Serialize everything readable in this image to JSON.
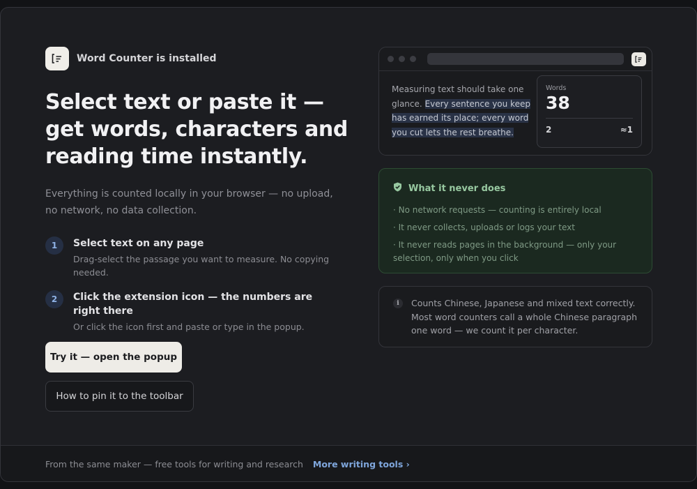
{
  "brand": {
    "name": "Word Counter is installed",
    "icon": "word-counter-logo-icon"
  },
  "hero": {
    "headline": "Select text or paste it — get words, characters and reading time instantly.",
    "subhead": "Everything is counted locally in your browser — no upload, no network, no data collection."
  },
  "steps": [
    {
      "number": "1",
      "title": "Select text on any page",
      "description": "Drag-select the passage you want to measure. No copying needed."
    },
    {
      "number": "2",
      "title": "Click the extension icon — the numbers are right there",
      "description": "Or click the icon first and paste or type in the popup."
    }
  ],
  "actions": {
    "primary_label": "Try it — open the popup",
    "secondary_label": "How to pin it to the toolbar"
  },
  "preview": {
    "text_plain": "Measuring text should take one glance.",
    "text_selected": "Every sentence you keep has earned its place; every word you cut lets the rest breathe.",
    "popup": {
      "label": "Words",
      "value": "38",
      "stat_left": "2",
      "stat_right": "≈1"
    }
  },
  "privacy": {
    "title": "What it never does",
    "items": [
      "· No network requests — counting is entirely local",
      "· It never collects, uploads or logs your text",
      "· It never reads pages in the background — only your selection, only when you click"
    ]
  },
  "info": {
    "icon_glyph": "i",
    "text": "Counts Chinese, Japanese and mixed text correctly. Most word counters call a whole Chinese paragraph one word — we count it per character."
  },
  "footer": {
    "text": "From the same maker — free tools for writing and research",
    "link_label": "More writing tools ›"
  },
  "colors": {
    "accent_link": "#7fa6dc",
    "success": "#98c9a1",
    "background": "#1c1d21"
  }
}
